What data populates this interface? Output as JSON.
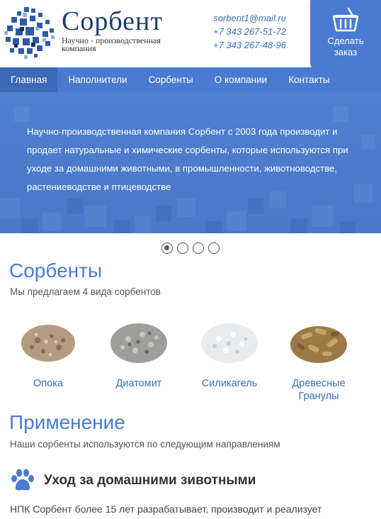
{
  "header": {
    "brand_name": "Сорбент",
    "brand_tagline": "Научно - производственная компания",
    "email": "sorbent1@mail.ru",
    "phone1": "+7 343 267-51-72",
    "phone2": "+7 343 267-48-96",
    "order_button_label": "Сделать заказ"
  },
  "nav": {
    "items": [
      "Главная",
      "Наполнители",
      "Сорбенты",
      "О компании",
      "Контакты"
    ],
    "active": "Главная"
  },
  "hero": {
    "text": "Научно-производственная компания Сорбент с 2003 года производит и продает натуральные и химические сорбенты, которые используются при уходе за домашними животными, в промышленности, животноводстве, растениеводстве и птицеводстве"
  },
  "slider": {
    "count": 4,
    "active_index": 0
  },
  "sorbents": {
    "title": "Сорбенты",
    "subtitle": "Мы предлагаем 4 вида сорбентов",
    "items": [
      "Опока",
      "Диатомит",
      "Силикагель",
      "Древесные Гранулы"
    ]
  },
  "application": {
    "title": "Применение",
    "subtitle": "Наши сорбенты используются по следующим направлениям",
    "item_title": "Уход за домашними зивотными",
    "item_text": "НПК Сорбент более 15 лет разрабатывает, производит и реализует"
  },
  "colors": {
    "accent": "#4a7bd0",
    "brand": "#1f3a6b",
    "link": "#3b6fb6"
  },
  "icons": {
    "cart": "basket-icon",
    "paw": "paw-icon"
  }
}
